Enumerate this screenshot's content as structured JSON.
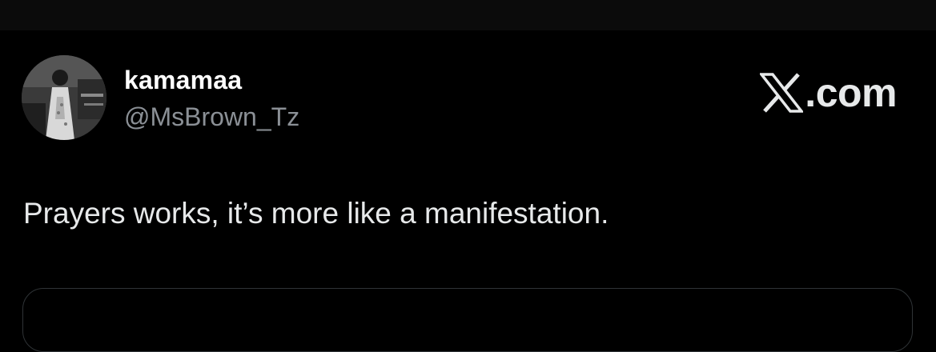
{
  "post": {
    "display_name": "kamamaa",
    "handle": "@MsBrown_Tz",
    "text": "Prayers works, it’s more like a manifestation.",
    "avatar_icon": "profile-photo-avatar"
  },
  "brand": {
    "x_icon": "x-logo-icon",
    "suffix": ".com"
  },
  "colors": {
    "background": "#000000",
    "primary_text": "#e7e9ea",
    "secondary_text": "#8b9096",
    "border": "#2f3336"
  }
}
